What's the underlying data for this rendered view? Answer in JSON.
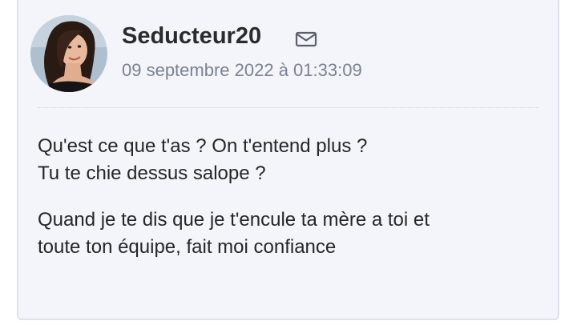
{
  "post": {
    "username": "Seducteur20",
    "timestamp": "09 septembre 2022 à 01:33:09",
    "paragraphs": [
      [
        "Qu'est ce que t'as ? On t'entend plus ?",
        "Tu te chie dessus salope ?"
      ],
      [
        "Quand je te dis que je t'encule ta mère a toi et",
        "toute ton équipe, fait moi confiance"
      ]
    ]
  },
  "icons": {
    "mail": "envelope-icon"
  },
  "colors": {
    "card_bg": "#f3f5fb",
    "card_border": "#dde2ec",
    "username": "#2b2b2b",
    "timestamp": "#7b8190",
    "body_text": "#262626"
  }
}
